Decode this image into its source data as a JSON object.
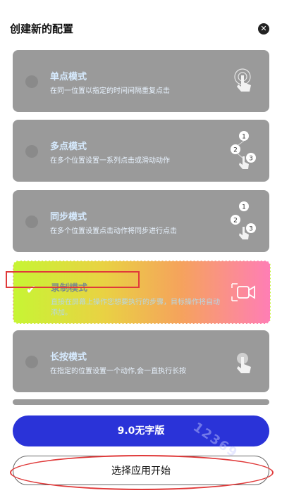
{
  "header": {
    "title": "创建新的配置",
    "close_icon": "close-icon"
  },
  "modes": [
    {
      "name": "单点模式",
      "desc": "在同一位置以指定的时间间隔重复点击",
      "icon": "single-tap-icon"
    },
    {
      "name": "多点模式",
      "desc": "在多个位置设置一系列点击或滑动动作",
      "icon": "multi-tap-icon",
      "badges": [
        "1",
        "2",
        "3"
      ]
    },
    {
      "name": "同步模式",
      "desc": "在多个位置设置点击动作将同步进行点击",
      "icon": "sync-tap-icon",
      "badges": [
        "1",
        "2",
        "3"
      ]
    },
    {
      "name": "录制模式",
      "desc": "直接在屏幕上操作您想要执行的步骤，目标操作将自动添加。",
      "icon": "video-record-icon",
      "selected": true
    },
    {
      "name": "长按模式",
      "desc": "在指定的位置设置一个动作,会一直执行长按",
      "icon": "long-press-icon"
    }
  ],
  "buttons": {
    "primary": "9.0无字版",
    "secondary": "选择应用开始"
  },
  "watermark": "12369",
  "colors": {
    "primary": "#2a33d8",
    "card_gray": "#9a9a9a",
    "annotation": "#e03a3a"
  }
}
